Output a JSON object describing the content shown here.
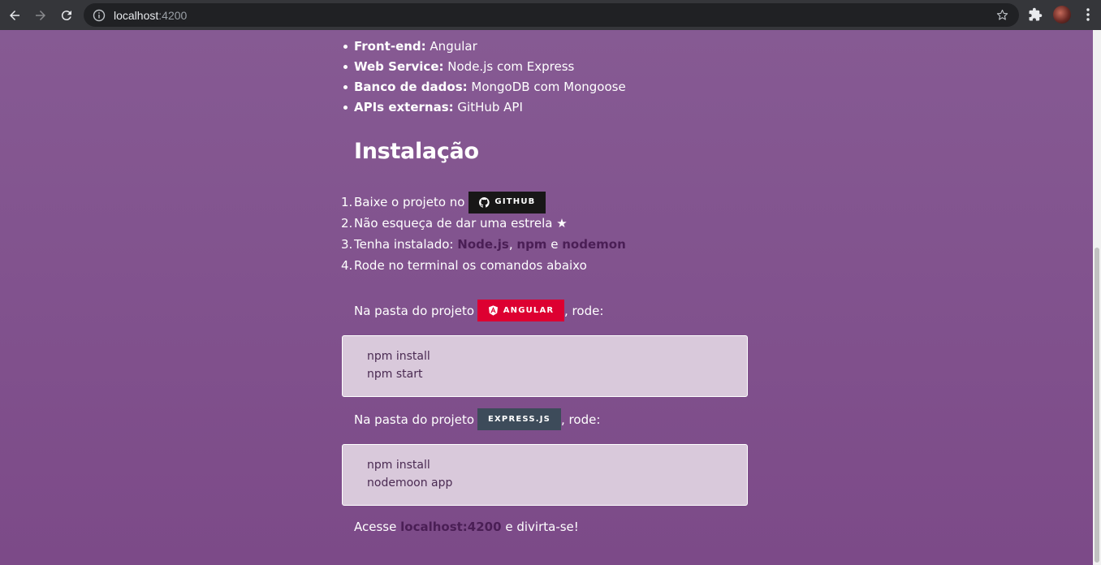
{
  "browser": {
    "url_host": "localhost",
    "url_port": ":4200"
  },
  "stack": [
    {
      "label": "Front-end:",
      "value": " Angular"
    },
    {
      "label": "Web Service:",
      "value": " Node.js com Express"
    },
    {
      "label": "Banco de dados:",
      "value": " MongoDB com Mongoose"
    },
    {
      "label": "APIs externas:",
      "value": " GitHub API"
    }
  ],
  "install": {
    "title": "Instalação",
    "steps": {
      "s1_num": "1.",
      "s1_text": "Baixe o projeto no",
      "github_badge": "GITHUB",
      "s2_num": "2.",
      "s2_text": "Não esqueça de dar uma estrela ★",
      "s3_num": "3.",
      "s3_text": "Tenha instalado:",
      "s3_node": "Node.js",
      "s3_comma": ",",
      "s3_npm": "npm",
      "s3_and": "e",
      "s3_nodemon": "nodemon",
      "s4_num": "4.",
      "s4_text": "Rode no terminal os comandos abaixo"
    },
    "angular_para": {
      "before": "Na pasta do projeto",
      "badge": "ANGULAR",
      "after": ", rode:"
    },
    "angular_cmds": [
      "npm install",
      "npm start"
    ],
    "express_para": {
      "before": "Na pasta do projeto",
      "badge": "EXPRESS.JS",
      "after": ", rode:"
    },
    "express_cmds": [
      "npm install",
      "nodemoon app"
    ],
    "final": {
      "before": "Acesse",
      "link": "localhost:4200",
      "after": "e divirta-se!"
    }
  },
  "colors": {
    "page_bg": "#7c4a88",
    "github_badge": "#181717",
    "angular_badge": "#dd0031",
    "express_badge": "#3d4b5a",
    "link": "#4a1e55"
  }
}
